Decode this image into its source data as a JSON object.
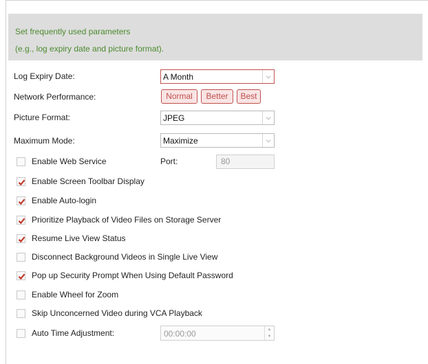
{
  "tip": {
    "line1": "Set frequently used parameters",
    "line2": "(e.g., log expiry date and picture format)."
  },
  "log_expiry": {
    "label": "Log Expiry Date:",
    "value": "A Month"
  },
  "network": {
    "label": "Network Performance:",
    "options": [
      "Normal",
      "Better",
      "Best"
    ]
  },
  "picture_format": {
    "label": "Picture Format:",
    "value": "JPEG"
  },
  "maximum_mode": {
    "label": "Maximum Mode:",
    "value": "Maximize"
  },
  "web_service": {
    "label": "Enable Web Service",
    "checked": false,
    "port_label": "Port:",
    "port_value": "80"
  },
  "checkboxes": [
    {
      "label": "Enable Screen Toolbar Display",
      "checked": true
    },
    {
      "label": "Enable Auto-login",
      "checked": true
    },
    {
      "label": "Prioritize Playback of Video Files on Storage Server",
      "checked": true
    },
    {
      "label": "Resume Live View Status",
      "checked": true
    },
    {
      "label": "Disconnect Background Videos in Single Live View",
      "checked": false
    },
    {
      "label": "Pop up Security Prompt When Using Default Password",
      "checked": true
    },
    {
      "label": "Enable Wheel for Zoom",
      "checked": false
    },
    {
      "label": "Skip Unconcerned Video during VCA Playback",
      "checked": false
    }
  ],
  "auto_time": {
    "label": "Auto Time Adjustment:",
    "checked": false,
    "value": "00:00:00"
  },
  "colors": {
    "tip_text": "#4c8a2e",
    "accent_red": "#c0504d",
    "tip_background": "#dddddd"
  }
}
